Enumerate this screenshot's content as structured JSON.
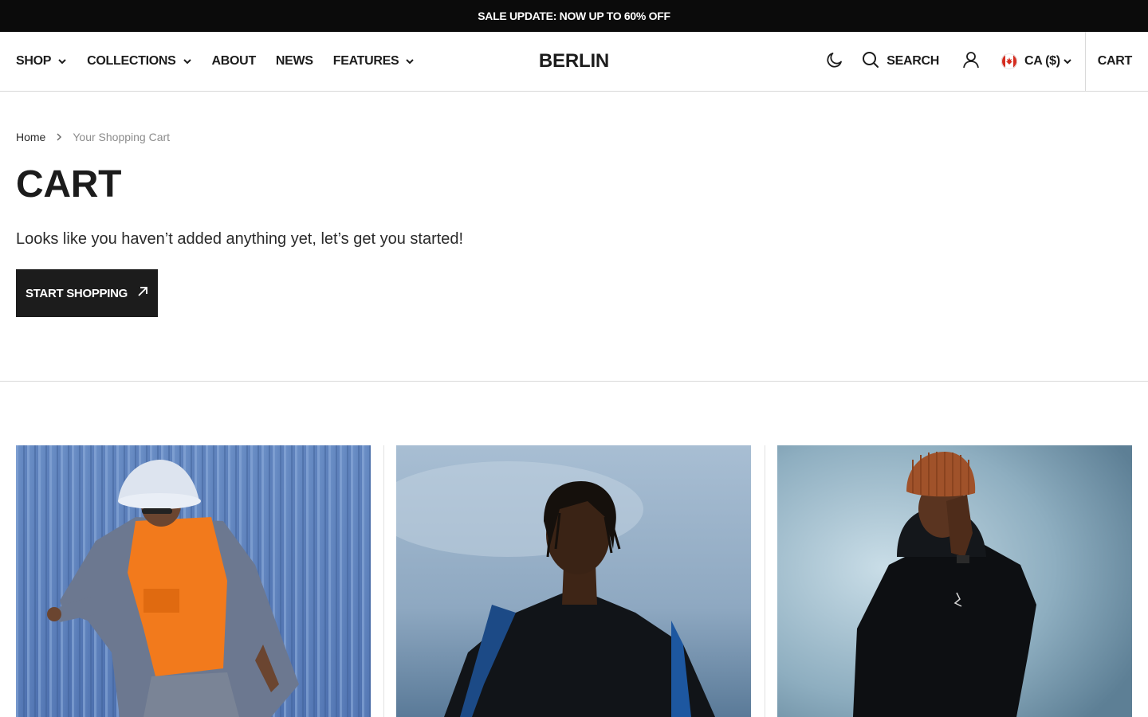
{
  "announcement": {
    "text": "SALE UPDATE: NOW UP TO 60% OFF"
  },
  "header": {
    "nav": [
      {
        "label": "SHOP",
        "has_dropdown": true
      },
      {
        "label": "COLLECTIONS",
        "has_dropdown": true
      },
      {
        "label": "ABOUT",
        "has_dropdown": false
      },
      {
        "label": "NEWS",
        "has_dropdown": false
      },
      {
        "label": "FEATURES",
        "has_dropdown": true
      }
    ],
    "logo": "BERLIN",
    "search_label": "SEARCH",
    "currency_label": "CA ($)",
    "cart_label": "CART",
    "icons": {
      "theme": "moon-icon",
      "search": "search-icon",
      "account": "user-icon",
      "flag": "canada-flag-icon",
      "dropdown": "chevron-down-icon"
    }
  },
  "breadcrumb": {
    "home": "Home",
    "current": "Your Shopping Cart"
  },
  "main": {
    "title": "CART",
    "empty_message": "Looks like you haven’t added anything yet, let’s get you started!",
    "cta_label": "START SHOPPING",
    "cta_icon": "arrow-up-right-icon"
  },
  "collection_images": [
    {
      "name": "model-orange-hoodie-image"
    },
    {
      "name": "model-black-hoodie-image"
    },
    {
      "name": "model-brown-beanie-image"
    }
  ],
  "colors": {
    "announcement_bg": "#0b0b0b",
    "button_bg": "#1c1c1c",
    "text": "#1c1c1c",
    "muted_text": "#8c8c8c",
    "border": "#d9d9d9"
  }
}
